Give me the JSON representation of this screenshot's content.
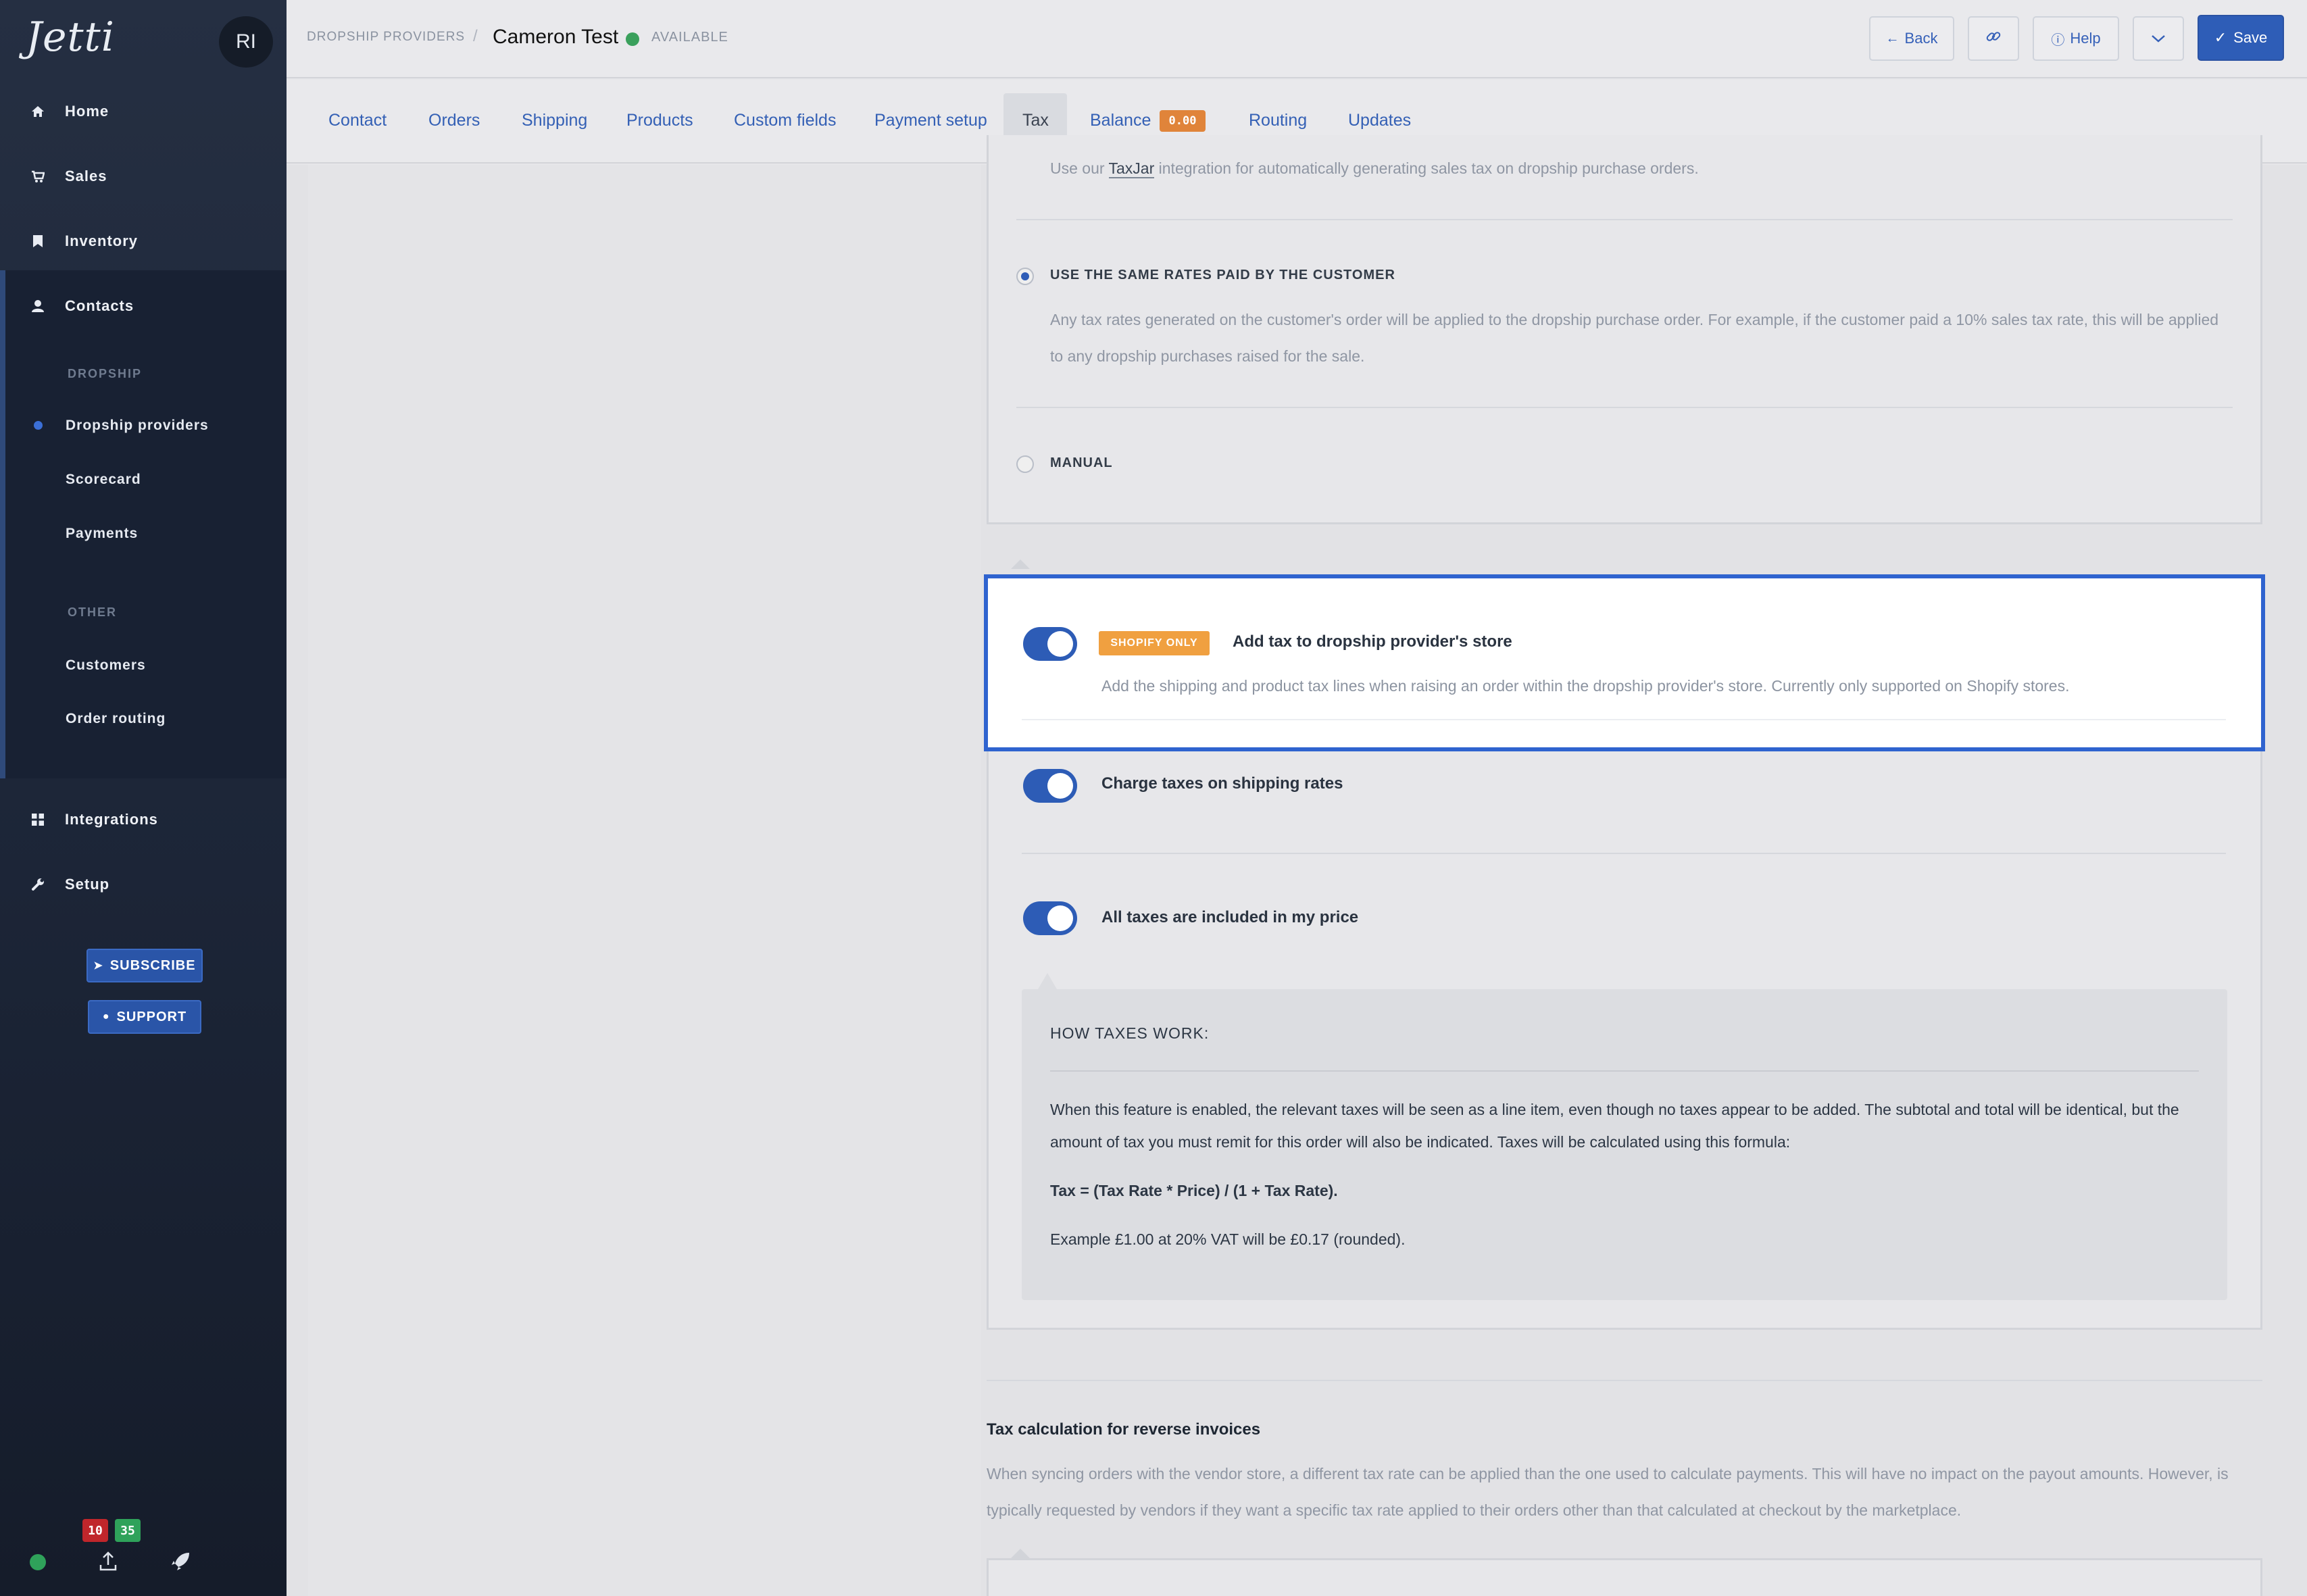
{
  "app": {
    "logo": "Jetti",
    "avatar_initials": "RI"
  },
  "sidebar": {
    "items": [
      {
        "label": "Home",
        "icon": "home-icon"
      },
      {
        "label": "Sales",
        "icon": "cart-icon"
      },
      {
        "label": "Inventory",
        "icon": "bookmark-icon"
      },
      {
        "label": "Contacts",
        "icon": "user-icon"
      },
      {
        "label": "Integrations",
        "icon": "grid-icon"
      },
      {
        "label": "Setup",
        "icon": "wrench-icon"
      }
    ],
    "dropship_section": "DROPSHIP",
    "dropship_items": [
      "Dropship providers",
      "Scorecard",
      "Payments"
    ],
    "other_section": "OTHER",
    "other_items": [
      "Customers",
      "Order routing"
    ],
    "subscribe_label": "SUBSCRIBE",
    "support_label": "SUPPORT",
    "badge_red": "10",
    "badge_green": "35",
    "colors": {
      "badge_red": "#c0262b",
      "badge_green": "#2fa25a",
      "accent": "#2e5db7"
    }
  },
  "header": {
    "breadcrumb": "DROPSHIP PROVIDERS",
    "breadcrumb_sep": "/",
    "title": "Cameron Test",
    "status": "AVAILABLE",
    "back_label": "Back",
    "help_label": "Help",
    "save_label": "Save"
  },
  "tabs": [
    {
      "label": "Contact"
    },
    {
      "label": "Orders"
    },
    {
      "label": "Shipping"
    },
    {
      "label": "Products"
    },
    {
      "label": "Custom fields"
    },
    {
      "label": "Payment setup"
    },
    {
      "label": "Tax",
      "active": true
    },
    {
      "label": "Balance",
      "badge": "0.00"
    },
    {
      "label": "Routing"
    },
    {
      "label": "Updates"
    }
  ],
  "tax": {
    "taxjar_pre": "Use our ",
    "taxjar_link": "TaxJar",
    "taxjar_post": " integration for automatically generating sales tax on dropship purchase orders.",
    "option_same_label": "USE THE SAME RATES PAID BY THE CUSTOMER",
    "option_same_desc": "Any tax rates generated on the customer's order will be applied to the dropship purchase order. For example, if the customer paid a 10% sales tax rate, this will be applied to any dropship purchases raised for the sale.",
    "option_manual_label": "MANUAL",
    "shopify_badge": "SHOPIFY ONLY",
    "add_tax_label": "Add tax to dropship provider's store",
    "add_tax_desc": "Add the shipping and product tax lines when raising an order within the dropship provider's store. Currently only supported on Shopify stores.",
    "charge_shipping_label": "Charge taxes on shipping rates",
    "included_label": "All taxes are included in my price",
    "how_title": "HOW TAXES WORK:",
    "how_text": "When this feature is enabled, the relevant taxes will be seen as a line item, even though no taxes appear to be added. The subtotal and total will be identical, but the amount of tax you must remit for this order will also be indicated. Taxes will be calculated using this formula:",
    "formula": "Tax = (Tax Rate * Price) / (1 + Tax Rate).",
    "example": "Example £1.00 at 20% VAT will be £0.17 (rounded).",
    "reverse_title": "Tax calculation for reverse invoices",
    "reverse_desc": "When syncing orders with the vendor store, a different tax rate can be applied than the one used to calculate payments. This will have no impact on the payout amounts. However, is typically requested by vendors if they want a specific tax rate applied to their orders other than that calculated at checkout by the marketplace."
  }
}
